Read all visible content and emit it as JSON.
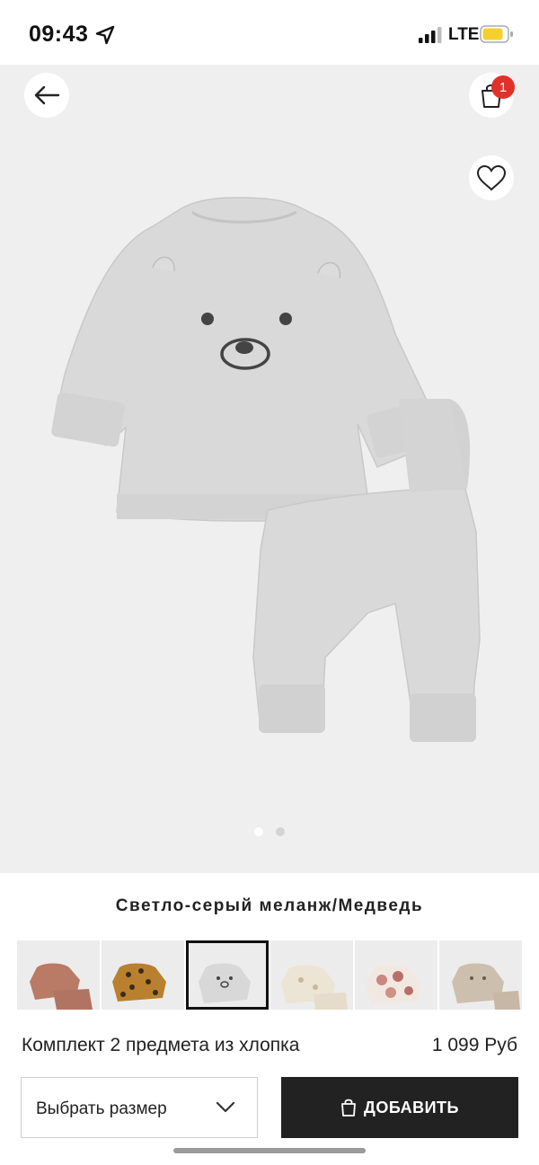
{
  "status_bar": {
    "time": "09:43",
    "network": "LTE",
    "icons": [
      "location-arrow-icon",
      "signal-icon",
      "battery-icon"
    ]
  },
  "header": {
    "cart_count": "1",
    "icons": [
      "back-arrow-icon",
      "shopping-bag-icon",
      "heart-icon"
    ]
  },
  "gallery": {
    "slides": 2,
    "active_slide": 1
  },
  "product": {
    "color_name": "Светло-серый меланж/Медведь",
    "name": "Комплект 2 предмета из хлопка",
    "price": "1 099 Руб",
    "swatch_count": 6,
    "selected_swatch": 3
  },
  "actions": {
    "size_label": "Выбрать размер",
    "add_label": "ДОБАВИТЬ"
  },
  "colors": {
    "accent": "#e0312b",
    "button_dark": "#222222",
    "hero_bg": "#efefef",
    "garment_grey": "#d9d9d9"
  }
}
